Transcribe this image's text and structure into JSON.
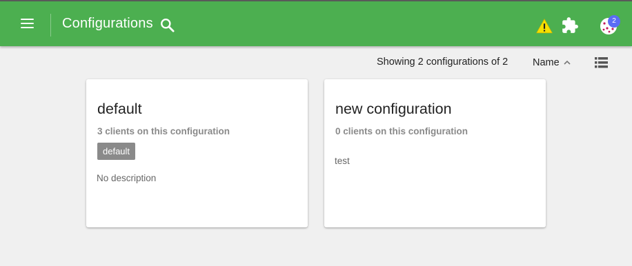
{
  "header": {
    "title": "Configurations",
    "accent_color": "#4caf50",
    "icons": [
      "menu-icon",
      "search-icon",
      "warning-icon",
      "puzzle-icon",
      "avatar-icon"
    ],
    "notification_count": "2"
  },
  "toolbar": {
    "showing_text": "Showing 2 configurations of 2",
    "sort_label": "Name",
    "sort_direction": "ascending"
  },
  "cards": [
    {
      "title": "default",
      "clients": "3 clients on this configuration",
      "tag": "default",
      "description": "No description"
    },
    {
      "title": "new configuration",
      "clients": "0 clients on this configuration",
      "description": "test"
    }
  ]
}
